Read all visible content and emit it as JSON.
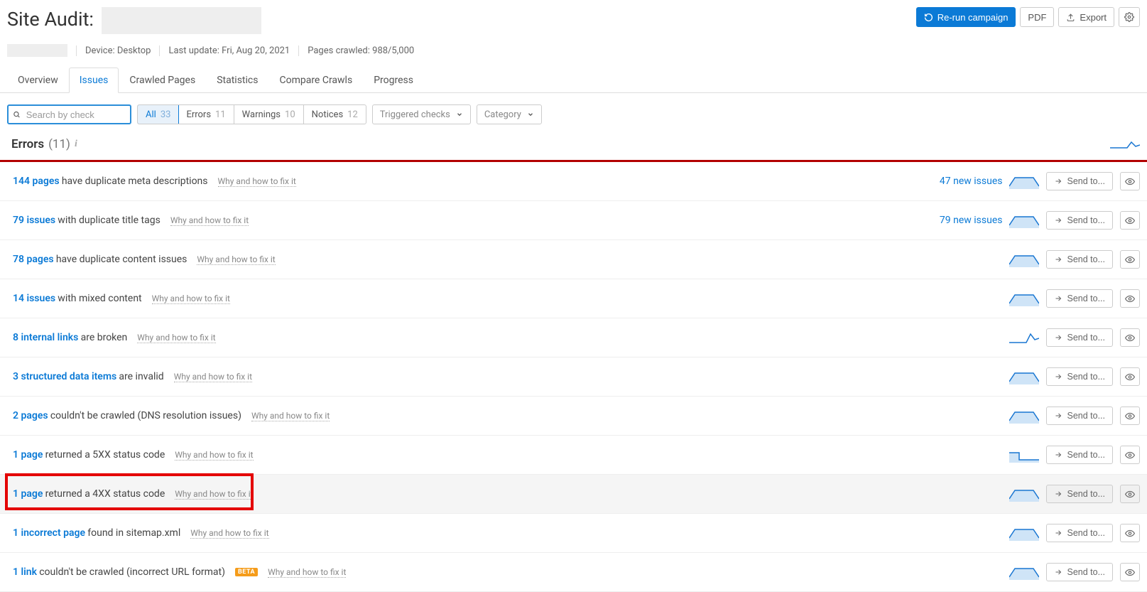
{
  "page": {
    "title_prefix": "Site Audit:"
  },
  "actions": {
    "rerun": "Re-run campaign",
    "pdf": "PDF",
    "export": "Export"
  },
  "meta": {
    "device_label": "Device:",
    "device_value": "Desktop",
    "last_update_label": "Last update:",
    "last_update_value": "Fri, Aug 20, 2021",
    "pages_crawled_label": "Pages crawled:",
    "pages_crawled_value": "988/5,000"
  },
  "tabs": [
    {
      "label": "Overview"
    },
    {
      "label": "Issues"
    },
    {
      "label": "Crawled Pages"
    },
    {
      "label": "Statistics"
    },
    {
      "label": "Compare Crawls"
    },
    {
      "label": "Progress"
    }
  ],
  "filters": {
    "search_placeholder": "Search by check",
    "segments": [
      {
        "label": "All",
        "count": "33"
      },
      {
        "label": "Errors",
        "count": "11"
      },
      {
        "label": "Warnings",
        "count": "10"
      },
      {
        "label": "Notices",
        "count": "12"
      }
    ],
    "dd_triggered": "Triggered checks",
    "dd_category": "Category"
  },
  "section": {
    "title": "Errors",
    "count": "(11)"
  },
  "shared": {
    "fix_text": "Why and how to fix it",
    "send_to": "Send to..."
  },
  "rows": [
    {
      "link": "144 pages",
      "rest": "have duplicate meta descriptions",
      "new": "47 new issues",
      "spark_type": 1
    },
    {
      "link": "79 issues",
      "rest": "with duplicate title tags",
      "new": "79 new issues",
      "spark_type": 1
    },
    {
      "link": "78 pages",
      "rest": "have duplicate content issues",
      "new": "",
      "spark_type": 1
    },
    {
      "link": "14 issues",
      "rest": "with mixed content",
      "new": "",
      "spark_type": 1
    },
    {
      "link": "8 internal links",
      "rest": "are broken",
      "new": "",
      "spark_type": 2
    },
    {
      "link": "3 structured data items",
      "rest": "are invalid",
      "new": "",
      "spark_type": 1
    },
    {
      "link": "2 pages",
      "rest": "couldn't be crawled (DNS resolution issues)",
      "new": "",
      "spark_type": 1
    },
    {
      "link": "1 page",
      "rest": "returned a 5XX status code",
      "new": "",
      "spark_type": 3
    },
    {
      "link": "1 page",
      "rest": "returned a 4XX status code",
      "new": "",
      "spark_type": 1,
      "highlight": true,
      "hover": true
    },
    {
      "link": "1 incorrect page",
      "rest": "found in sitemap.xml",
      "new": "",
      "spark_type": 1
    },
    {
      "link": "1 link",
      "rest": "couldn't be crawled (incorrect URL format)",
      "new": "",
      "spark_type": 1,
      "beta": "BETA"
    }
  ]
}
